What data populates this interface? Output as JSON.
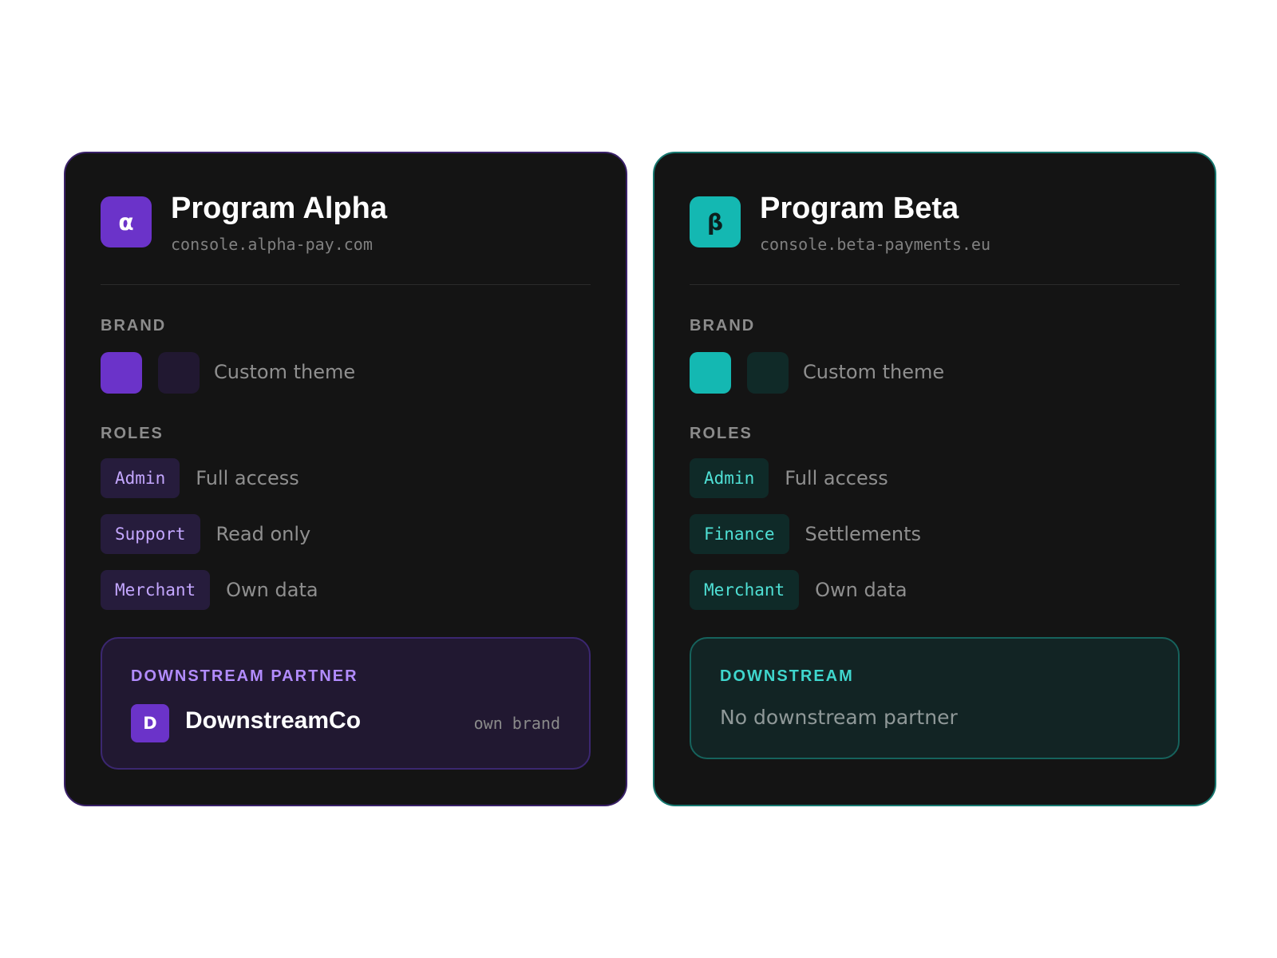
{
  "programs": [
    {
      "name": "Program Alpha",
      "logo_glyph": "α",
      "domain": "console.alpha-pay.com",
      "accent_color": "#6B33C9",
      "brand": {
        "label": "BRAND",
        "swatches": [
          "#6B33C9",
          "#211831"
        ],
        "theme_text": "Custom theme"
      },
      "roles": {
        "label": "ROLES",
        "items": [
          {
            "name": "Admin",
            "description": "Full access"
          },
          {
            "name": "Support",
            "description": "Read only"
          },
          {
            "name": "Merchant",
            "description": "Own data"
          }
        ]
      },
      "downstream": {
        "label": "DOWNSTREAM PARTNER",
        "partner_initial": "D",
        "partner_name": "DownstreamCo",
        "partner_note": "own brand"
      }
    },
    {
      "name": "Program Beta",
      "logo_glyph": "β",
      "domain": "console.beta-payments.eu",
      "accent_color": "#14B8B2",
      "brand": {
        "label": "BRAND",
        "swatches": [
          "#14B8B2",
          "#102A28"
        ],
        "theme_text": "Custom theme"
      },
      "roles": {
        "label": "ROLES",
        "items": [
          {
            "name": "Admin",
            "description": "Full access"
          },
          {
            "name": "Finance",
            "description": "Settlements"
          },
          {
            "name": "Merchant",
            "description": "Own data"
          }
        ]
      },
      "downstream": {
        "label": "DOWNSTREAM",
        "empty_text": "No downstream partner"
      }
    }
  ]
}
